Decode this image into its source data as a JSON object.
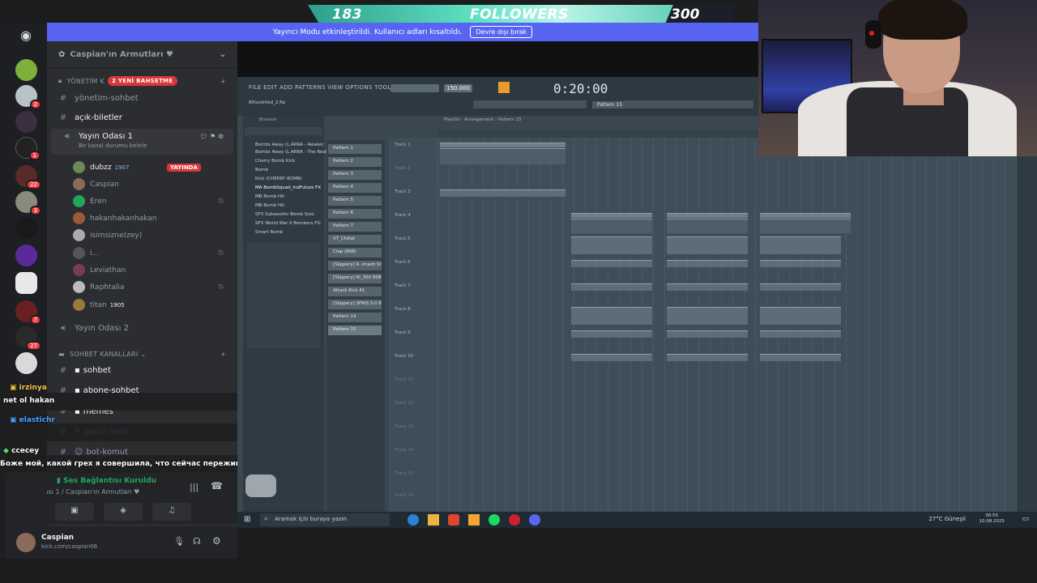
{
  "banner": {
    "count": "183",
    "label": "FOLLOWERS",
    "goal": "300"
  },
  "streamer_mode": {
    "text": "Yayıncı Modu etkinleştirildi. Kullanıcı adları kısaltıldı.",
    "button": "Devre dışı bırak"
  },
  "server": {
    "name": "Caspian'ın Armutları ♥"
  },
  "channels": {
    "category_admin": "YÖNETİM K",
    "mention_badge": "2 YENİ BAHSETME",
    "yonetim_sohbet": "yönetim-sohbet",
    "acik_biletler": "açık-biletler",
    "voice1": "Yayın Odası 1",
    "voice1_status": "Bir kanal durumu belirle",
    "voice2": "Yayın Odası 2",
    "category_chat": "SOHBET KANALLARI",
    "sohbet": "sohbet",
    "abone_sohbet": "abone-sohbet",
    "memes": "memes",
    "gartic": "gartic-best",
    "bot_komut": "bot-komut"
  },
  "voice_users": [
    {
      "name": "dubzz",
      "extra": "1907",
      "live": "YAYINDA"
    },
    {
      "name": "Caspian",
      "extra": "",
      "live": ""
    },
    {
      "name": "Eren",
      "extra": "",
      "live": ""
    },
    {
      "name": "hakanhakanhakan",
      "extra": "",
      "live": ""
    },
    {
      "name": "isimsizne(zey)",
      "extra": "",
      "live": ""
    },
    {
      "name": "i...",
      "extra": "",
      "live": ""
    },
    {
      "name": "Leviathan",
      "extra": "",
      "live": ""
    },
    {
      "name": "Raphtalia",
      "extra": "",
      "live": ""
    },
    {
      "name": "titan",
      "extra": "1905",
      "live": ""
    }
  ],
  "voice_panel": {
    "status": "Ses Bağlantısı Kuruldu",
    "location": "Yayın Odası 1 / Caspian'ın Armutları ♥"
  },
  "user_panel": {
    "name": "Caspian",
    "sub": "kick.com/caspian06"
  },
  "server_badges": [
    "2",
    "1",
    "22",
    "3",
    "1",
    "7",
    "27"
  ],
  "chat": [
    {
      "user": "irzinya",
      "msg": "net ol hakan",
      "color": "#f5c542"
    },
    {
      "user": "elastichr",
      "msg": "",
      "color": "#4da3ff"
    },
    {
      "user": "ccecey",
      "msg": "Боже мой, какой грех я совершила, что сейчас переживаю это?",
      "color": "#ffffff"
    }
  ],
  "fl": {
    "menu": "FILE EDIT ADD PATTERNS VIEW OPTIONS TOOLS HELP",
    "tempo": "150.000",
    "time": "0:20:00",
    "pattern_selector": "Pattern 15",
    "file_label": "80\\untitled_2.flp",
    "browser_title": "Browser",
    "playlist_title": "Playlist - Arrangement › Pattern 15",
    "browser_items": [
      "Bombs Away (L.ARRA - Awake)",
      "Bombs Away (L.ARRA - The Realm)",
      "Cherry Bomb Kick",
      "Bomb",
      "Kick (CHERRY BOMB)",
      "MA BombSquad_IndFuture FX",
      "MB Bomb Hit",
      "MB Bomb Hit",
      "SFX Subwoofer Bomb Solo",
      "SFX World War II Bombers FG",
      "Smart Bomb"
    ],
    "patterns": [
      "Pattern 1",
      "Pattern 2",
      "Pattern 3",
      "Pattern 4",
      "Pattern 5",
      "Pattern 6",
      "Pattern 7",
      "VT_Chillat",
      "Clap (808)",
      "[Slippery] R..imash Snare",
      "[Slippery] Rl_300 808(1)",
      "Attack Kick 41",
      "[Slippery] SFRIS 3.0 808",
      "Pattern 14",
      "Pattern 15"
    ],
    "tracks": [
      "Track 1",
      "Track 2",
      "Track 3",
      "Track 4",
      "Track 5",
      "Track 6",
      "Track 7",
      "Track 8",
      "Track 9",
      "Track 10",
      "Track 11",
      "Track 12",
      "Track 13",
      "Track 14",
      "Track 15",
      "Track 16"
    ]
  },
  "taskbar": {
    "search": "Aramak için buraya yazın",
    "weather": "27°C Güneşli",
    "time": "00:55",
    "date": "10.08.2025"
  }
}
